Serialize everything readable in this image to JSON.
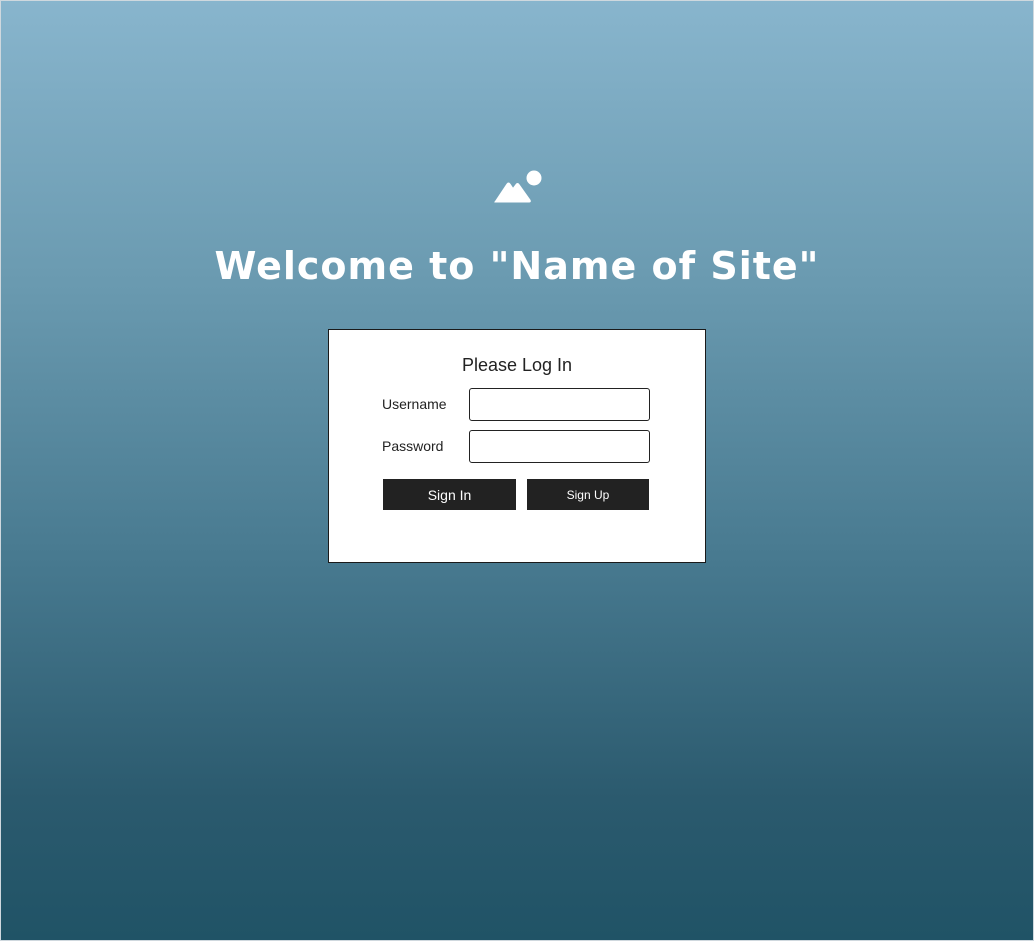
{
  "header": {
    "logo_icon": "mountain-sun-icon",
    "title": "Welcome to \"Name of Site\""
  },
  "login": {
    "heading": "Please Log In",
    "username_label": "Username",
    "username_value": "",
    "password_label": "Password",
    "password_value": "",
    "sign_in_label": "Sign In",
    "sign_up_label": "Sign Up"
  },
  "colors": {
    "gradient_top": "#88b5cd",
    "gradient_bottom": "#205366",
    "button_bg": "#222222",
    "button_text": "#ffffff"
  }
}
